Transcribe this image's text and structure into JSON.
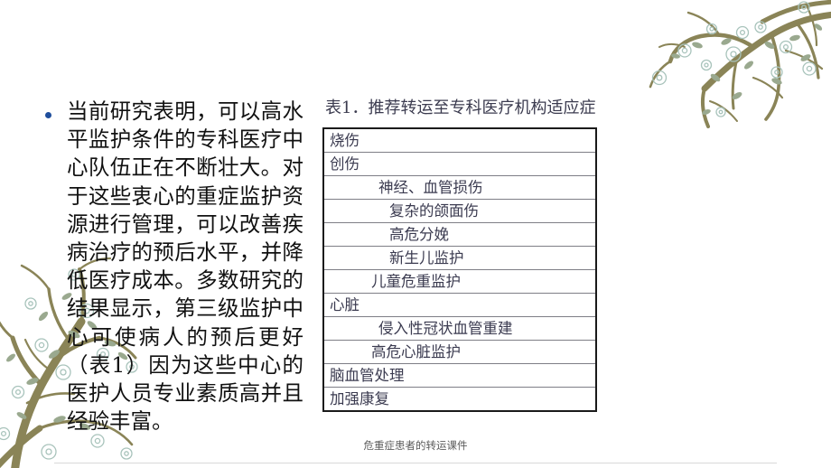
{
  "slide": {
    "background_color": "#ffffff",
    "bullet_color": "#1f4e9c",
    "branch_color": "#8a8457",
    "blossom_color": "#b9ccc6"
  },
  "body": {
    "bullet_paragraph": "当前研究表明，可以高水平监护条件的专科医疗中心队伍正在不断壮大。对于这些衷心的重症监护资源进行管理，可以改善疾病治疗的预后水平，并降低医疗成本。多数研究的结果显示，第三级监护中心可使病人的预后更好（表1）因为这些中心的医护人员专业素质高并且经验丰富。"
  },
  "table": {
    "title": "表1．推荐转运至专科医疗机构适应症",
    "rows": [
      {
        "label": "烧伤",
        "level": 1
      },
      {
        "label": "创伤",
        "level": 1
      },
      {
        "label": "神经、血管损伤",
        "level": 2
      },
      {
        "label": "复杂的颌面伤",
        "level": 2
      },
      {
        "label": "高危分娩",
        "level": 2
      },
      {
        "label": "新生儿监护",
        "level": 2
      },
      {
        "label": "儿童危重监护",
        "level": 2
      },
      {
        "label": "心脏",
        "level": 1
      },
      {
        "label": "侵入性冠状血管重建",
        "level": 2
      },
      {
        "label": "高危心脏监护",
        "level": 2
      },
      {
        "label": "脑血管处理",
        "level": 1
      },
      {
        "label": "加强康复",
        "level": 1
      }
    ]
  },
  "footer": {
    "text": "危重症患者的转运课件"
  }
}
